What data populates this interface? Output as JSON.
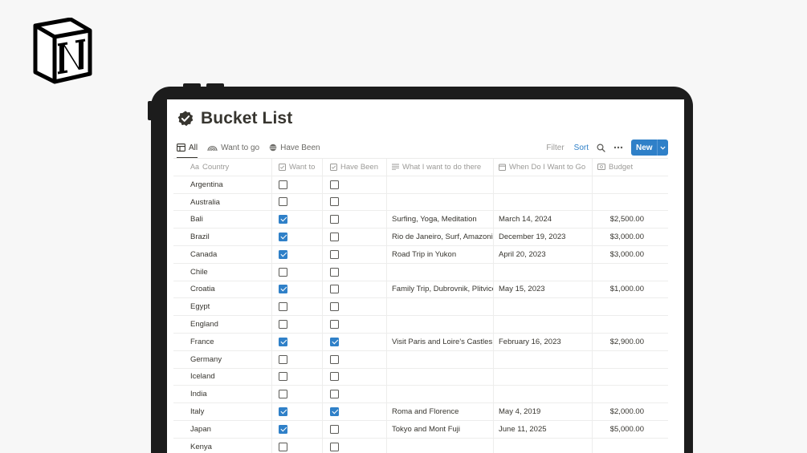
{
  "page": {
    "title": "Bucket List",
    "icon": "verified-badge-icon"
  },
  "views": [
    {
      "label": "All",
      "icon": "table-icon",
      "active": true
    },
    {
      "label": "Want to go",
      "icon": "rainbow-icon",
      "active": false
    },
    {
      "label": "Have Been",
      "icon": "globe-icon",
      "active": false
    }
  ],
  "toolbar": {
    "filter_label": "Filter",
    "sort_label": "Sort",
    "new_label": "New",
    "accent_color": "#2f80c8"
  },
  "columns": [
    {
      "label": "Country",
      "icon": "text-aa-icon"
    },
    {
      "label": "Want to",
      "icon": "checkbox-icon"
    },
    {
      "label": "Have Been",
      "icon": "checkbox-icon"
    },
    {
      "label": "What I want to do there",
      "icon": "text-lines-icon"
    },
    {
      "label": "When Do I Want to Go",
      "icon": "calendar-icon"
    },
    {
      "label": "Budget",
      "icon": "money-icon"
    }
  ],
  "rows": [
    {
      "country": "Argentina",
      "want": false,
      "been": false,
      "what": "",
      "when": "",
      "budget": ""
    },
    {
      "country": "Australia",
      "want": false,
      "been": false,
      "what": "",
      "when": "",
      "budget": ""
    },
    {
      "country": "Bali",
      "want": true,
      "been": false,
      "what": "Surfing, Yoga, Meditation",
      "when": "March 14, 2024",
      "budget": "$2,500.00"
    },
    {
      "country": "Brazil",
      "want": true,
      "been": false,
      "what": "Rio de Janeiro, Surf, Amazonia",
      "when": "December 19, 2023",
      "budget": "$3,000.00"
    },
    {
      "country": "Canada",
      "want": true,
      "been": false,
      "what": "Road Trip in Yukon",
      "when": "April 20, 2023",
      "budget": "$3,000.00"
    },
    {
      "country": "Chile",
      "want": false,
      "been": false,
      "what": "",
      "when": "",
      "budget": ""
    },
    {
      "country": "Croatia",
      "want": true,
      "been": false,
      "what": "Family Trip, Dubrovnik, Plitvice",
      "when": "May 15, 2023",
      "budget": "$1,000.00"
    },
    {
      "country": "Egypt",
      "want": false,
      "been": false,
      "what": "",
      "when": "",
      "budget": ""
    },
    {
      "country": "England",
      "want": false,
      "been": false,
      "what": "",
      "when": "",
      "budget": ""
    },
    {
      "country": "France",
      "want": true,
      "been": true,
      "what": "Visit Paris and Loire's Castles",
      "when": "February 16, 2023",
      "budget": "$2,900.00"
    },
    {
      "country": "Germany",
      "want": false,
      "been": false,
      "what": "",
      "when": "",
      "budget": ""
    },
    {
      "country": "Iceland",
      "want": false,
      "been": false,
      "what": "",
      "when": "",
      "budget": ""
    },
    {
      "country": "India",
      "want": false,
      "been": false,
      "what": "",
      "when": "",
      "budget": ""
    },
    {
      "country": "Italy",
      "want": true,
      "been": true,
      "what": "Roma and Florence",
      "when": "May 4, 2019",
      "budget": "$2,000.00"
    },
    {
      "country": "Japan",
      "want": true,
      "been": false,
      "what": "Tokyo and Mont Fuji",
      "when": "June 11, 2025",
      "budget": "$5,000.00"
    },
    {
      "country": "Kenya",
      "want": false,
      "been": false,
      "what": "",
      "when": "",
      "budget": ""
    }
  ]
}
